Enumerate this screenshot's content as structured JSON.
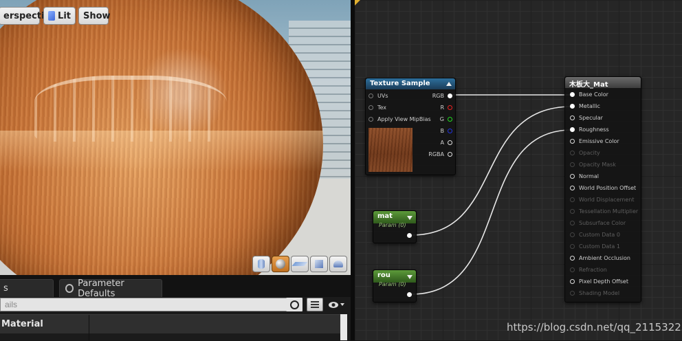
{
  "viewport": {
    "perspective_label": "erspective",
    "lit_label": "Lit",
    "show_label": "Show",
    "preview_shapes": [
      "cylinder-icon",
      "sphere-icon",
      "plane-icon",
      "cube-icon",
      "custom-mesh-icon"
    ],
    "active_shape": "sphere-icon"
  },
  "details": {
    "tab1_label": "s",
    "tab2_label": "Parameter Defaults",
    "search_placeholder": "ails",
    "section_label": "Material"
  },
  "graph": {
    "texture_node": {
      "title": "Texture Sample",
      "inputs": [
        "UVs",
        "Tex",
        "Apply View MipBias"
      ],
      "outputs": [
        "RGB",
        "R",
        "G",
        "B",
        "A",
        "RGBA"
      ]
    },
    "mat_node": {
      "title": "mat",
      "subtitle": "Param (0)"
    },
    "rou_node": {
      "title": "rou",
      "subtitle": "Param (0)"
    },
    "material_node": {
      "title": "木板大_Mat",
      "inputs": [
        {
          "label": "Base Color",
          "enabled": true
        },
        {
          "label": "Metallic",
          "enabled": true
        },
        {
          "label": "Specular",
          "enabled": true
        },
        {
          "label": "Roughness",
          "enabled": true
        },
        {
          "label": "Emissive Color",
          "enabled": true
        },
        {
          "label": "Opacity",
          "enabled": false
        },
        {
          "label": "Opacity Mask",
          "enabled": false
        },
        {
          "label": "Normal",
          "enabled": true
        },
        {
          "label": "World Position Offset",
          "enabled": true
        },
        {
          "label": "World Displacement",
          "enabled": false
        },
        {
          "label": "Tessellation Multiplier",
          "enabled": false
        },
        {
          "label": "Subsurface Color",
          "enabled": false
        },
        {
          "label": "Custom Data 0",
          "enabled": false
        },
        {
          "label": "Custom Data 1",
          "enabled": false
        },
        {
          "label": "Ambient Occlusion",
          "enabled": true
        },
        {
          "label": "Refraction",
          "enabled": false
        },
        {
          "label": "Pixel Depth Offset",
          "enabled": true
        },
        {
          "label": "Shading Model",
          "enabled": false
        }
      ]
    }
  },
  "watermark": "https://blog.csdn.net/qq_21153225"
}
